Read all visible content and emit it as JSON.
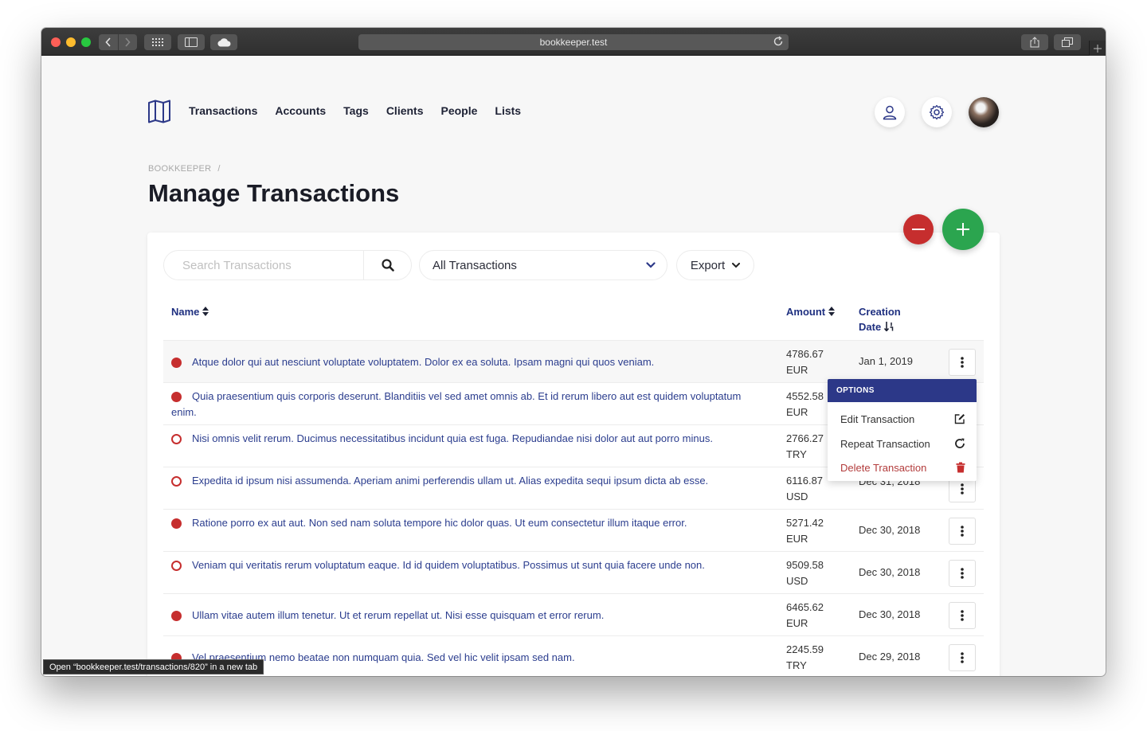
{
  "browser": {
    "url": "bookkeeper.test",
    "status_link": "Open “bookkeeper.test/transactions/820” in a new tab"
  },
  "nav": {
    "items": [
      "Transactions",
      "Accounts",
      "Tags",
      "Clients",
      "People",
      "Lists"
    ]
  },
  "breadcrumb": {
    "root": "BOOKKEEPER",
    "separator": "/"
  },
  "page": {
    "title": "Manage Transactions"
  },
  "toolbar": {
    "search_placeholder": "Search Transactions",
    "filter_selected": "All Transactions",
    "export_label": "Export"
  },
  "table": {
    "headers": {
      "name": "Name",
      "amount": "Amount",
      "date": "Creation Date"
    },
    "rows": [
      {
        "status": "filled",
        "name": "Atque dolor qui aut nesciunt voluptate voluptatem. Dolor ex ea soluta. Ipsam magni qui quos veniam.",
        "amount": "4786.67",
        "currency": "EUR",
        "date": "Jan 1, 2019"
      },
      {
        "status": "filled",
        "name": "Quia praesentium quis corporis deserunt. Blanditiis vel sed amet omnis ab. Et id rerum libero aut est quidem voluptatum enim.",
        "amount": "4552.58",
        "currency": "EUR",
        "date": ""
      },
      {
        "status": "hollow",
        "name": "Nisi omnis velit rerum. Ducimus necessitatibus incidunt quia est fuga. Repudiandae nisi dolor aut aut porro minus.",
        "amount": "2766.27",
        "currency": "TRY",
        "date": ""
      },
      {
        "status": "hollow",
        "name": "Expedita id ipsum nisi assumenda. Aperiam animi perferendis ullam ut. Alias expedita sequi ipsum dicta ab esse.",
        "amount": "6116.87",
        "currency": "USD",
        "date": "Dec 31, 2018"
      },
      {
        "status": "filled",
        "name": "Ratione porro ex aut aut. Non sed nam soluta tempore hic dolor quas. Ut eum consectetur illum itaque error.",
        "amount": "5271.42",
        "currency": "EUR",
        "date": "Dec 30, 2018"
      },
      {
        "status": "hollow",
        "name": "Veniam qui veritatis rerum voluptatum eaque. Id id quidem voluptatibus. Possimus ut sunt quia facere unde non.",
        "amount": "9509.58",
        "currency": "USD",
        "date": "Dec 30, 2018"
      },
      {
        "status": "filled",
        "name": "Ullam vitae autem illum tenetur. Ut et rerum repellat ut. Nisi esse quisquam et error rerum.",
        "amount": "6465.62",
        "currency": "EUR",
        "date": "Dec 30, 2018"
      },
      {
        "status": "filled",
        "name": "Vel praesentium nemo beatae non numquam quia. Sed vel hic velit ipsam sed nam.",
        "amount": "2245.59",
        "currency": "TRY",
        "date": "Dec 29, 2018"
      }
    ]
  },
  "options_menu": {
    "header": "OPTIONS",
    "items": [
      "Edit Transaction",
      "Repeat Transaction",
      "Delete Transaction"
    ]
  },
  "colors": {
    "brand_navy": "#2c3888",
    "link_blue": "#2b3d8e",
    "danger_red": "#c62e2e",
    "success_green": "#2ba54f"
  }
}
